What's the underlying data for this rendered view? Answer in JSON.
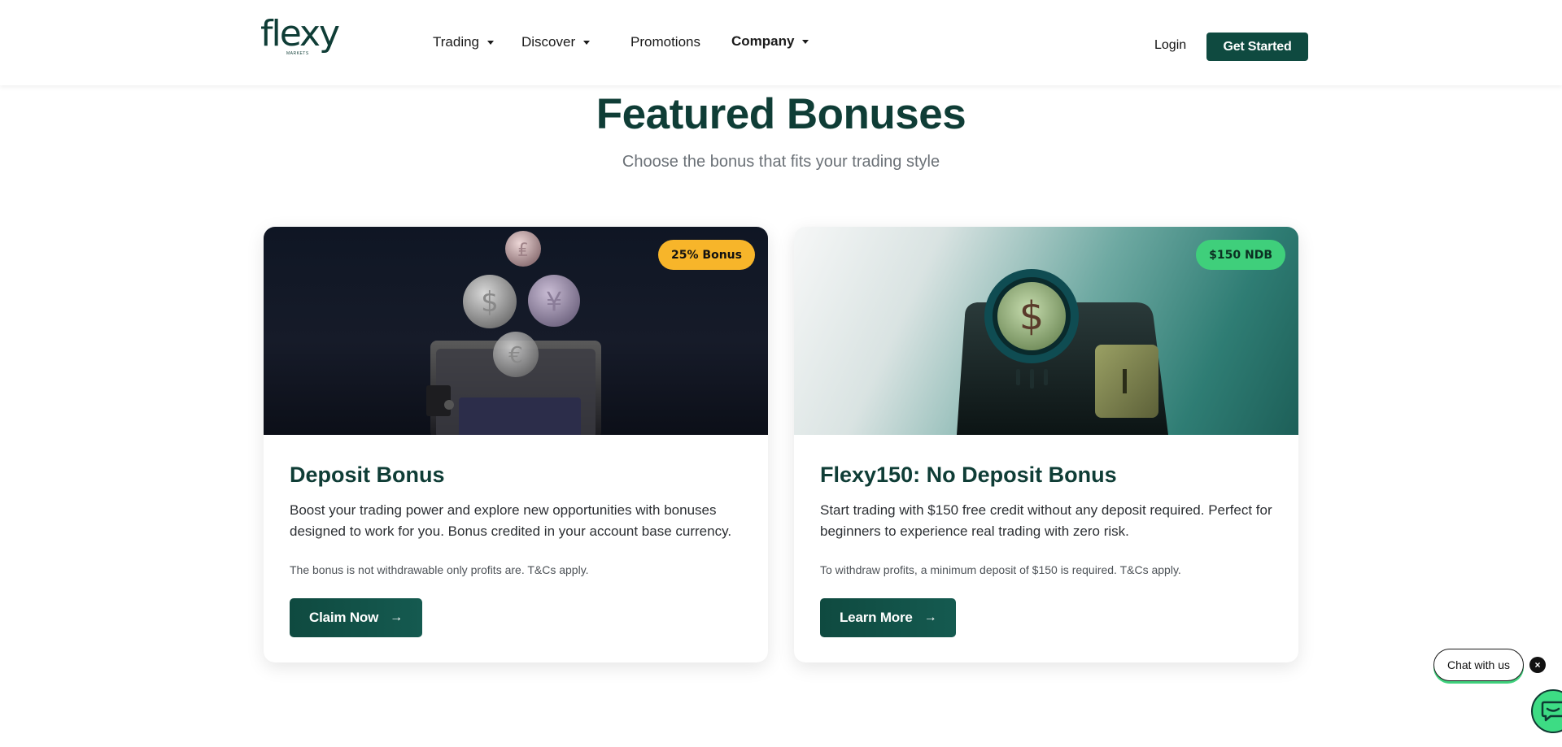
{
  "header": {
    "logo_text": "flexy",
    "logo_sub": "MARKETS",
    "nav": {
      "trading": "Trading",
      "discover": "Discover",
      "promotions": "Promotions",
      "company": "Company"
    },
    "login": "Login",
    "get_started": "Get Started"
  },
  "hero": {
    "title": "Featured Bonuses",
    "subtitle": "Choose the bonus that fits your trading style"
  },
  "cards": [
    {
      "badge": "25% Bonus",
      "title": "Deposit Bonus",
      "description": "Boost your trading power and explore new opportunities with bonuses designed to work for you. Bonus credited in your account base currency.",
      "note": "The bonus is not withdrawable only profits are. T&Cs apply.",
      "button": "Claim Now",
      "image_icon": "wallet-with-coins-illustration"
    },
    {
      "badge": "$150 NDB",
      "title": "Flexy150: No Deposit Bonus",
      "description": "Start trading with $150 free credit without any deposit required. Perfect for beginners to experience real trading with zero risk.",
      "note": "To withdraw profits, a minimum deposit of $150 is required. T&Cs apply.",
      "button": "Learn More",
      "image_icon": "dollar-coin-card-illustration"
    }
  ],
  "chat": {
    "label": "Chat with us",
    "close": "×"
  },
  "colors": {
    "brand": "#0f4a40",
    "badge_yellow": "#f7b52a",
    "badge_green": "#3fcf7b",
    "chat_green": "#3ddc84"
  }
}
